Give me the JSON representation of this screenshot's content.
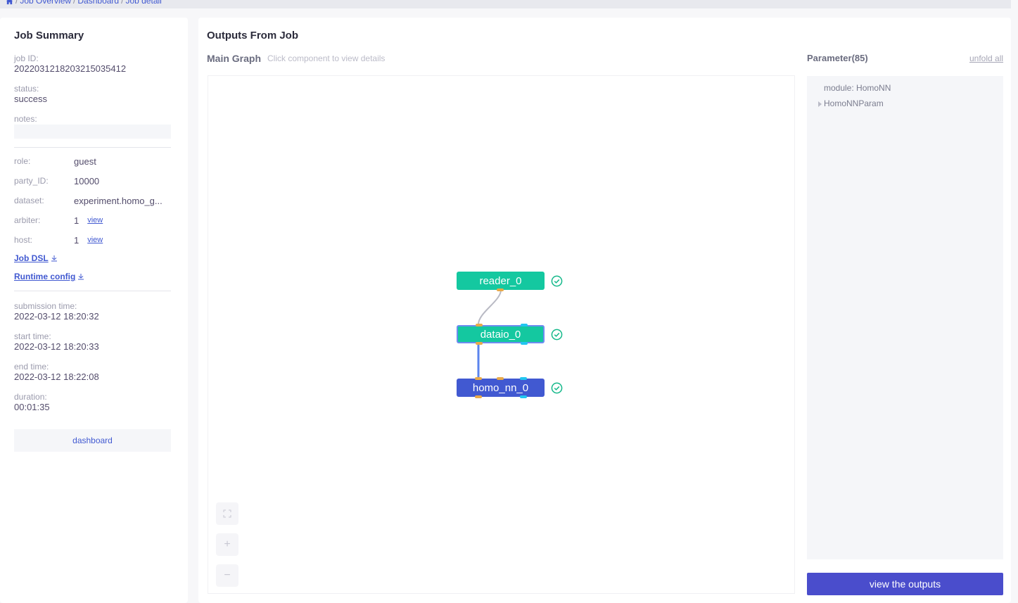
{
  "breadcrumb": {
    "items": [
      "Job Overview",
      "Dashboard",
      "Job detail"
    ]
  },
  "summary": {
    "title": "Job Summary",
    "job_id_label": "job ID:",
    "job_id": "202203121820321503541​2",
    "status_label": "status:",
    "status": "success",
    "notes_label": "notes:",
    "notes": "",
    "role_label": "role:",
    "role": "guest",
    "party_id_label": "party_ID:",
    "party_id": "10000",
    "dataset_label": "dataset:",
    "dataset": "experiment.homo_g...",
    "arbiter_label": "arbiter:",
    "arbiter_count": "1",
    "host_label": "host:",
    "host_count": "1",
    "view_label": "view",
    "job_dsl_label": "Job DSL",
    "runtime_config_label": "Runtime config",
    "submission_time_label": "submission time:",
    "submission_time": "2022-03-12 18:20:32",
    "start_time_label": "start time:",
    "start_time": "2022-03-12 18:20:33",
    "end_time_label": "end time:",
    "end_time": "2022-03-12 18:22:08",
    "duration_label": "duration:",
    "duration": "00:01:35",
    "dashboard_button": "dashboard"
  },
  "outputs": {
    "title": "Outputs From Job",
    "graph_title": "Main Graph",
    "graph_hint": "Click component to view details",
    "nodes": [
      {
        "name": "reader_0",
        "status": "success",
        "color": "#14c8a0"
      },
      {
        "name": "dataio_0",
        "status": "success",
        "color": "#14c8a0",
        "selected": true
      },
      {
        "name": "homo_nn_0",
        "status": "success",
        "color": "#4159d1"
      }
    ],
    "edges": [
      {
        "from": "reader_0",
        "to": "dataio_0",
        "type": "data"
      },
      {
        "from": "dataio_0",
        "to": "homo_nn_0",
        "type": "data"
      }
    ],
    "controls": {
      "fullscreen": "⛶",
      "zoom_in": "+",
      "zoom_out": "−"
    }
  },
  "parameters": {
    "title": "Parameter(85)",
    "unfold_all": "unfold all",
    "module_line": "module: HomoNN",
    "groups": [
      "HomoNNParam"
    ]
  },
  "actions": {
    "view_outputs": "view the outputs"
  },
  "colors": {
    "accent": "#4159d1",
    "success_node": "#14c8a0",
    "button": "#4a4dcc"
  }
}
